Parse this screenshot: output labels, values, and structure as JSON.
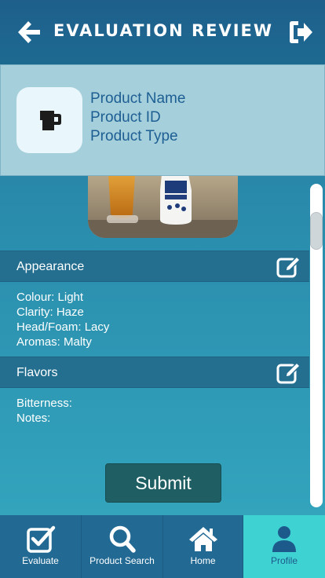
{
  "header": {
    "title": "EVALUATION REVIEW",
    "back_icon": "arrow-left-icon",
    "logout_icon": "sign-out-icon"
  },
  "product": {
    "icon": "beer-mug-icon",
    "name": "Product Name",
    "id": "Product ID",
    "type": "Product Type"
  },
  "appearance": {
    "title": "Appearance",
    "edit_icon": "edit-icon",
    "lines": [
      "Colour: Light",
      "Clarity: Haze",
      "Head/Foam: Lacy",
      "Aromas: Malty"
    ]
  },
  "flavors": {
    "title": "Flavors",
    "edit_icon": "edit-icon",
    "lines": [
      "Bitterness:",
      "Notes:"
    ]
  },
  "submit_label": "Submit",
  "nav": {
    "items": [
      {
        "label": "Evaluate",
        "icon": "checkbox-icon"
      },
      {
        "label": "Product Search",
        "icon": "search-icon"
      },
      {
        "label": "Home",
        "icon": "home-icon"
      },
      {
        "label": "Profile",
        "icon": "user-icon"
      }
    ],
    "active": "Profile"
  },
  "colors": {
    "header": "#1e5f8c",
    "active_nav": "#3fd2d2",
    "product_text": "#1d5f93",
    "submit_bg": "#1f5f64"
  }
}
